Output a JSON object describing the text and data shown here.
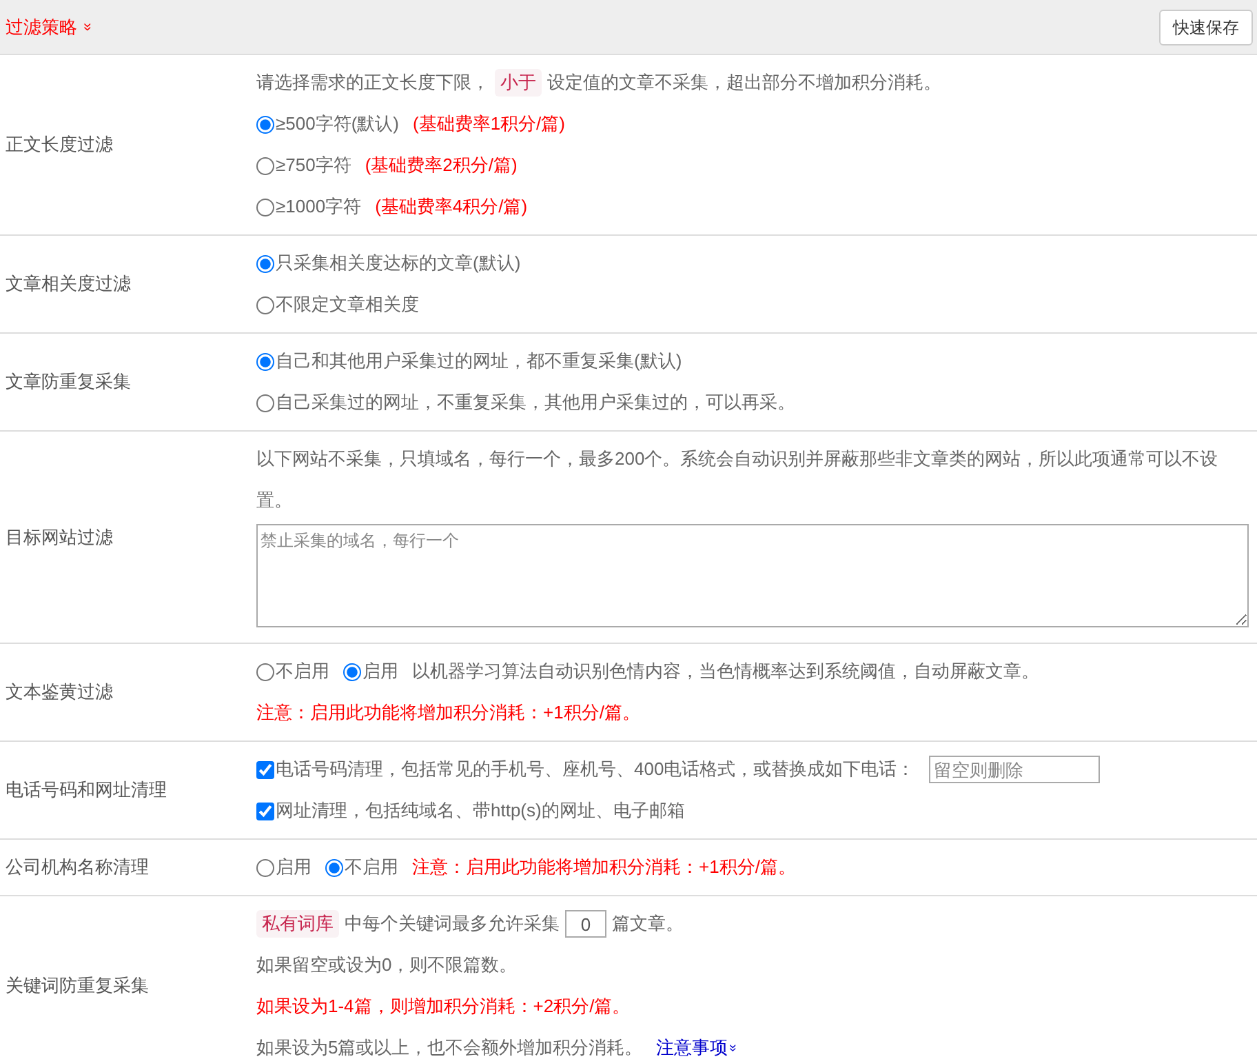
{
  "header": {
    "title": "过滤策略",
    "toggle": "»",
    "button": "快速保存"
  },
  "rows": [
    {
      "label": "正文长度过滤",
      "lines": [
        [
          {
            "kind": "text",
            "text": "请选择需求的正文长度下限，"
          },
          {
            "kind": "tag",
            "text": "小于"
          },
          {
            "kind": "text",
            "text": "设定值的文章不采集，超出部分不增加积分消耗。"
          }
        ],
        [
          {
            "kind": "radio",
            "text": "≥500字符(默认)",
            "selected": true
          },
          {
            "kind": "red",
            "text": "(基础费率1积分/篇)"
          }
        ],
        [
          {
            "kind": "radio",
            "text": "≥750字符",
            "selected": false
          },
          {
            "kind": "red",
            "text": "(基础费率2积分/篇)"
          }
        ],
        [
          {
            "kind": "radio",
            "text": "≥1000字符",
            "selected": false
          },
          {
            "kind": "red",
            "text": "(基础费率4积分/篇)"
          }
        ]
      ]
    },
    {
      "label": "文章相关度过滤",
      "lines": [
        [
          {
            "kind": "radio",
            "text": "只采集相关度达标的文章(默认)",
            "selected": true
          }
        ],
        [
          {
            "kind": "radio",
            "text": "不限定文章相关度",
            "selected": false
          }
        ]
      ]
    },
    {
      "label": "文章防重复采集",
      "lines": [
        [
          {
            "kind": "radio",
            "text": "自己和其他用户采集过的网址，都不重复采集(默认)",
            "selected": true
          }
        ],
        [
          {
            "kind": "radio",
            "text": "自己采集过的网址，不重复采集，其他用户采集过的，可以再采。",
            "selected": false
          }
        ]
      ]
    },
    {
      "label": "目标网站过滤",
      "lines": [
        [
          {
            "kind": "text",
            "text": "以下网站不采集，只填域名，每行一个，最多200个。系统会自动识别并屏蔽那些非文章类的网站，所以此项通常可以不设置。"
          }
        ],
        [
          {
            "kind": "textarea",
            "placeholder": "禁止采集的域名，每行一个"
          }
        ]
      ]
    },
    {
      "label": "文本鉴黄过滤",
      "lines": [
        [
          {
            "kind": "radio",
            "text": "不启用",
            "selected": false
          },
          {
            "kind": "radio",
            "text": "启用",
            "selected": true
          },
          {
            "kind": "text",
            "text": "以机器学习算法自动识别色情内容，当色情概率达到系统阈值，自动屏蔽文章。"
          }
        ],
        [
          {
            "kind": "red",
            "text": "注意：启用此功能将增加积分消耗：+1积分/篇。"
          }
        ]
      ]
    },
    {
      "label": "电话号码和网址清理",
      "lines": [
        [
          {
            "kind": "checkbox",
            "text": "电话号码清理，包括常见的手机号、座机号、400电话格式，或替换成如下电话：",
            "checked": true
          },
          {
            "kind": "input",
            "placeholder": "留空则删除"
          }
        ],
        [
          {
            "kind": "checkbox",
            "text": "网址清理，包括纯域名、带http(s)的网址、电子邮箱",
            "checked": true
          }
        ]
      ]
    },
    {
      "label": "公司机构名称清理",
      "lines": [
        [
          {
            "kind": "radio",
            "text": "启用",
            "selected": false
          },
          {
            "kind": "radio",
            "text": "不启用",
            "selected": true
          },
          {
            "kind": "red",
            "text": "注意：启用此功能将增加积分消耗：+1积分/篇。"
          }
        ]
      ]
    },
    {
      "label": "关键词防重复采集",
      "lines": [
        [
          {
            "kind": "tag",
            "text": "私有词库"
          },
          {
            "kind": "text",
            "text": "中每个关键词最多允许采集"
          },
          {
            "kind": "number",
            "value": "0"
          },
          {
            "kind": "text",
            "text": "篇文章。"
          }
        ],
        [
          {
            "kind": "text",
            "text": "如果留空或设为0，则不限篇数。"
          }
        ],
        [
          {
            "kind": "red",
            "text": "如果设为1-4篇，则增加积分消耗：+2积分/篇。"
          }
        ],
        [
          {
            "kind": "text",
            "text": "如果设为5篇或以上，也不会额外增加积分消耗。"
          },
          {
            "kind": "link",
            "text": "注意事项",
            "toggle": "»"
          }
        ]
      ]
    }
  ]
}
